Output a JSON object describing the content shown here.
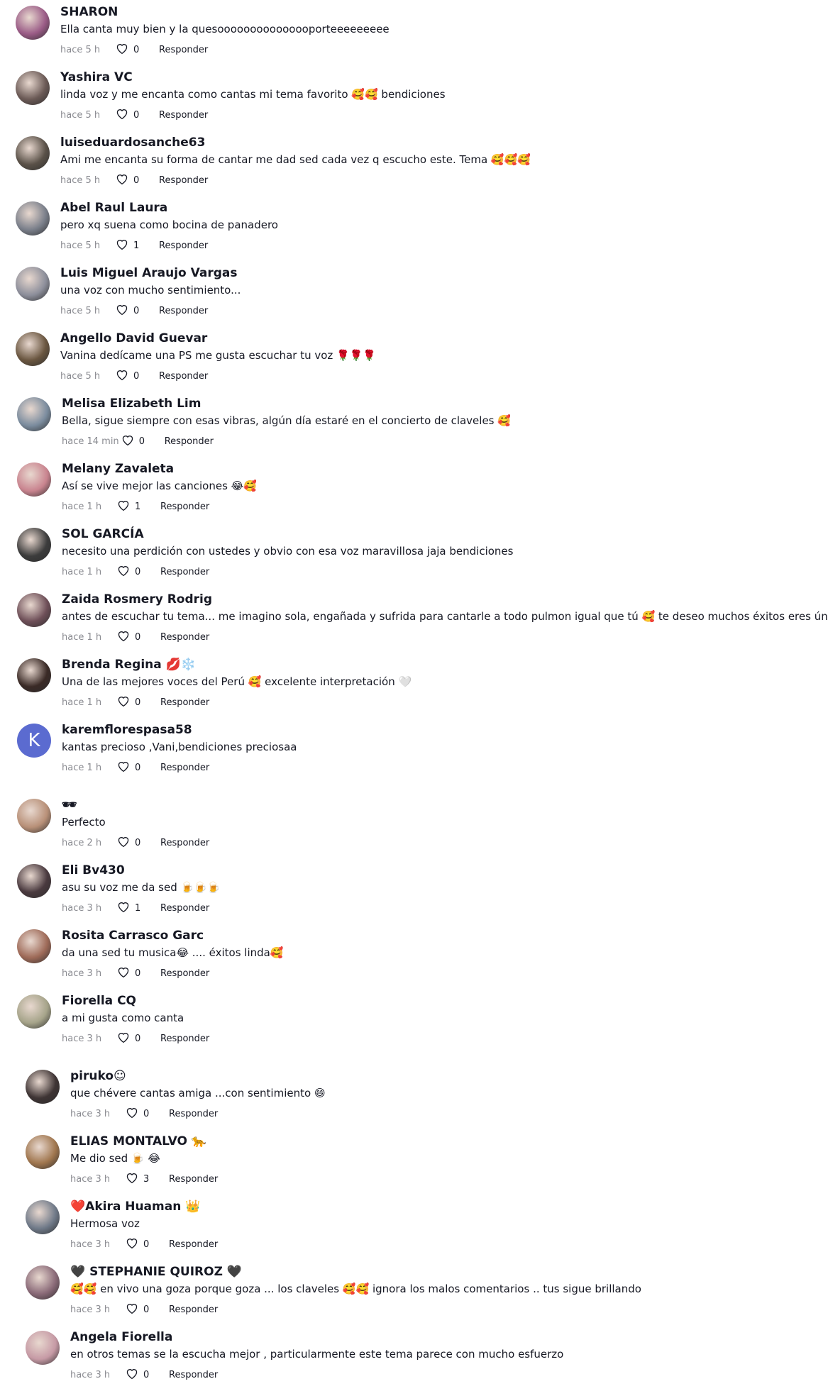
{
  "colors": {
    "text": "#161823",
    "muted": "#8a8b91",
    "background": "#ffffff"
  },
  "comments": [
    {
      "username": "SHARON",
      "text": "Ella canta muy bien y la quesooooooooooooooporteeeeeeeee",
      "time": "hace 5 h",
      "likes": "0",
      "reply": "Responder",
      "avatar_color": "#9a5b86"
    },
    {
      "username": "Yashira VC",
      "text": "linda voz y me encanta como cantas mi tema favorito 🥰🥰 bendiciones",
      "time": "hace 5 h",
      "likes": "0",
      "reply": "Responder",
      "avatar_color": "#6b5a56"
    },
    {
      "username": "luiseduardosanche63",
      "text": "Ami me encanta su forma de cantar me dad sed cada vez q escucho este. Tema 🥰🥰🥰",
      "time": "hace 5 h",
      "likes": "0",
      "reply": "Responder",
      "avatar_color": "#5a5148"
    },
    {
      "username": "Abel Raul Laura",
      "text": "pero xq suena como bocina de panadero",
      "time": "hace 5 h",
      "likes": "1",
      "reply": "Responder",
      "avatar_color": "#7a7f8a"
    },
    {
      "username": "Luis Miguel Araujo Vargas",
      "text": "una voz con mucho sentimiento...",
      "time": "hace 5 h",
      "likes": "0",
      "reply": "Responder",
      "avatar_color": "#8d8f9b"
    },
    {
      "username": "Angello David Guevar",
      "text": "Vanina dedícame una PS me gusta escuchar tu voz 🌹🌹🌹",
      "time": "hace 5 h",
      "likes": "0",
      "reply": "Responder",
      "avatar_color": "#6a5640"
    },
    {
      "username": "Melisa Elizabeth Lim",
      "text": "Bella, sigue siempre con esas vibras, algún día estaré en el concierto de claveles 🥰",
      "time": "hace 14 min",
      "likes": "0",
      "reply": "Responder",
      "avatar_color": "#7b8c9e"
    },
    {
      "username": "Melany Zavaleta",
      "text": "Así se vive mejor las canciones 😂🥰",
      "time": "hace 1 h",
      "likes": "1",
      "reply": "Responder",
      "avatar_color": "#c9848f"
    },
    {
      "username": "SOL GARCÍA",
      "text": "necesito una perdición con ustedes y obvio con esa voz maravillosa jaja bendiciones",
      "time": "hace 1 h",
      "likes": "0",
      "reply": "Responder",
      "avatar_color": "#3c3c3c"
    },
    {
      "username": "Zaida Rosmery Rodrig",
      "text": "antes de escuchar tu tema... me imagino sola, engañada y sufrida para cantarle a todo pulmon igual que tú 🥰 te deseo muchos éxitos eres única😜",
      "time": "hace 1 h",
      "likes": "0",
      "reply": "Responder",
      "avatar_color": "#6e4f58"
    },
    {
      "username": "Brenda Regina 💋❄️",
      "text": "Una de las mejores voces del Perú 🥰 excelente interpretación 🤍",
      "time": "hace 1 h",
      "likes": "0",
      "reply": "Responder",
      "avatar_color": "#3a2a26"
    },
    {
      "username": "karemflorespasa58",
      "text": "kantas precioso ,Vani,bendiciones preciosaa",
      "time": "hace 1 h",
      "likes": "0",
      "reply": "Responder",
      "avatar_color": "#5b6bd0",
      "initial": "K"
    },
    {
      "username": "🕶",
      "text": "Perfecto",
      "time": "hace 2 h",
      "likes": "0",
      "reply": "Responder",
      "avatar_color": "#b89078"
    },
    {
      "username": "Eli Bv430",
      "text": "asu su voz me da sed 🍺🍺🍺",
      "time": "hace 3 h",
      "likes": "1",
      "reply": "Responder",
      "avatar_color": "#4a3a3f"
    },
    {
      "username": "Rosita Carrasco Garc",
      "text": "da una sed tu musica😂 .... éxitos linda🥰",
      "time": "hace 3 h",
      "likes": "0",
      "reply": "Responder",
      "avatar_color": "#9e6a58"
    },
    {
      "username": "Fiorella CQ",
      "text": "a mi gusta como canta",
      "time": "hace 3 h",
      "likes": "0",
      "reply": "Responder",
      "avatar_color": "#a6a48a"
    },
    {
      "username": "piruko☺",
      "text": "que chévere cantas amiga ...con sentimiento 😄",
      "time": "hace 3 h",
      "likes": "0",
      "reply": "Responder",
      "avatar_color": "#3e3434"
    },
    {
      "username": "ELIAS MONTALVO 🐆",
      "text": "Me dio sed 🍺 😂",
      "time": "hace 3 h",
      "likes": "3",
      "reply": "Responder",
      "avatar_color": "#a0764e"
    },
    {
      "username": "❤️Akira Huaman 👑",
      "text": "Hermosa voz",
      "time": "hace 3 h",
      "likes": "0",
      "reply": "Responder",
      "avatar_color": "#6f7988"
    },
    {
      "username": "🖤 STEPHANIE QUIROZ 🖤",
      "text": "🥰🥰 en vivo una goza porque goza ... los claveles 🥰🥰 ignora los malos comentarios .. tus sigue brillando",
      "time": "hace 3 h",
      "likes": "0",
      "reply": "Responder",
      "avatar_color": "#8a6a78"
    },
    {
      "username": "Angela Fiorella",
      "text": "en otros temas se la escucha mejor , particularmente este tema parece con mucho esfuerzo",
      "time": "hace 3 h",
      "likes": "0",
      "reply": "Responder",
      "avatar_color": "#c69aa5"
    }
  ]
}
